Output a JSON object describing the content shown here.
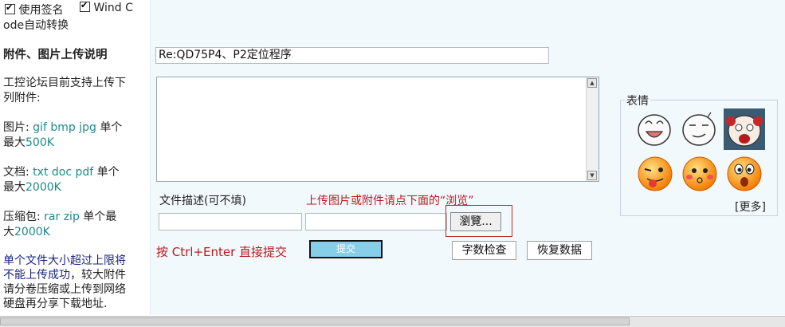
{
  "options": {
    "use_signature": "使用签名",
    "windcode_l1": "Wind C",
    "windcode_l2": "ode自动转换"
  },
  "sidebar": {
    "heading": "附件、图片上传说明",
    "intro_l1": "工控论坛目前支持上传下",
    "intro_l2": "列附件:",
    "image_label": "图片:",
    "image_types": "gif bmp jpg",
    "image_max_l1": "单个",
    "image_max_prefix": "最大",
    "image_max_val": "500K",
    "doc_label": "文档:",
    "doc_types": "txt doc pdf",
    "doc_max_l1": "单个",
    "doc_max_prefix": "最大",
    "doc_max_val": "2000K",
    "zip_label": "压缩包:",
    "zip_types": "rar zip",
    "zip_max_l1": "单个最",
    "zip_max_prefix": "大",
    "zip_max_val": "2000K",
    "note_navy_l1": "单个文件大小超过上限将",
    "note_navy_l2": "不能上传成功",
    "note_l2_rest": "，较大附件",
    "note_l3": "请分卷压缩或上传到网络",
    "note_l4": "硬盘再分享下载地址."
  },
  "form": {
    "title_value": "Re:QD75P4、P2定位程序",
    "file_desc_label": "文件描述(可不填)",
    "upload_hint": "上传图片或附件请点下面的“浏览”",
    "browse_label": "瀏覽...",
    "submit_hint": "按 Ctrl+Enter 直接提交",
    "submit_label": "提交",
    "wordcount_label": "字数检查",
    "restore_label": "恢复数据"
  },
  "emoticons": {
    "legend": "表情",
    "more_label": "[更多]",
    "items": [
      "white-grin-emoticon",
      "white-smirk-emoticon",
      "crying-face-emoticon",
      "tongue-wink-emoticon",
      "blush-emoticon",
      "surprised-emoticon"
    ]
  },
  "colors": {
    "teal": "#1f8a8a",
    "navy": "#1a237e",
    "red": "#b71c1c",
    "submit_bg": "#87ceeb",
    "panel_bg": "#f2f9fd"
  }
}
